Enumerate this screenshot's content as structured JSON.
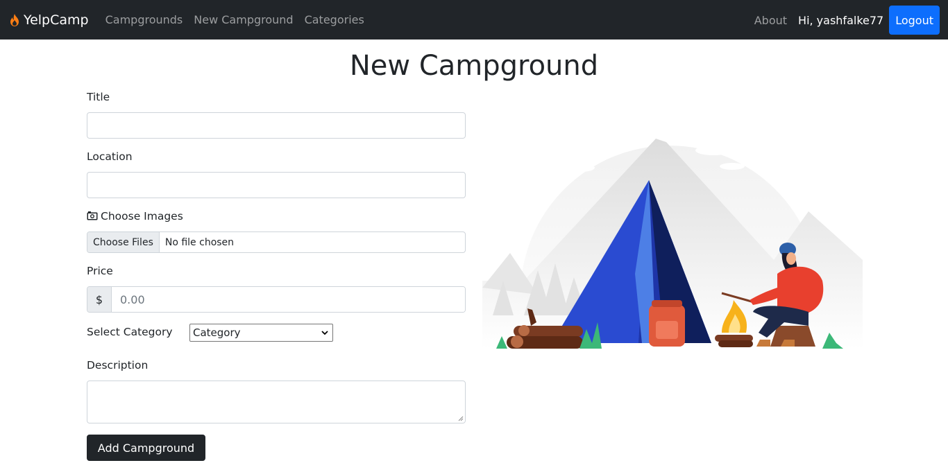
{
  "navbar": {
    "brand": "YelpCamp",
    "links": [
      {
        "label": "Campgrounds"
      },
      {
        "label": "New Campground"
      },
      {
        "label": "Categories"
      }
    ],
    "about_label": "About",
    "user_greeting": "Hi, yashfalke77",
    "logout_label": "Logout"
  },
  "page": {
    "title": "New Campground"
  },
  "form": {
    "title_label": "Title",
    "title_value": "",
    "location_label": "Location",
    "location_value": "",
    "images_label": "Choose Images",
    "file_button": "Choose Files",
    "file_status": "No file chosen",
    "price_label": "Price",
    "price_currency": "$",
    "price_placeholder": "0.00",
    "category_label": "Select Category",
    "category_selected": "Category",
    "description_label": "Description",
    "description_value": "",
    "submit_label": "Add Campground"
  },
  "colors": {
    "navbar_bg": "#212529",
    "brand_flame": "#fd7e14",
    "logout_bg": "#0d6efd",
    "submit_bg": "#212529",
    "tent_blue": "#2a4bd1"
  },
  "icons": {
    "brand": "flame-icon",
    "images": "camera-icon",
    "select": "chevron-down-icon"
  }
}
